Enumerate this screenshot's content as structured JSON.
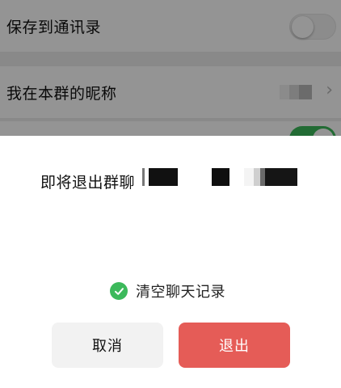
{
  "settings": {
    "save_to_contacts_label": "保存到通讯录",
    "group_nickname_label": "我在本群的昵称"
  },
  "dialog": {
    "title": "即将退出群聊",
    "clear_history_label": "清空聊天记录",
    "clear_history_checked": true,
    "cancel_label": "取消",
    "exit_label": "退出"
  },
  "colors": {
    "accent_green": "#3cb95b",
    "danger_red": "#e55c57",
    "cancel_bg": "#f2f2f2"
  },
  "icons": {
    "chevron": "chevron-right-icon",
    "check": "check-circle-icon"
  }
}
